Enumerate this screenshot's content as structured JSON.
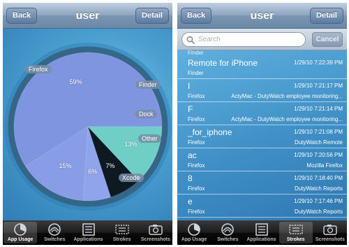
{
  "left": {
    "nav": {
      "back": "Back",
      "title": "user",
      "detail": "Detail"
    },
    "chart_data": {
      "type": "pie",
      "slices": [
        {
          "label": "Firefox",
          "value": 59,
          "value_label": "59%",
          "color": "#7f95e0"
        },
        {
          "label": "Finder",
          "value": 15,
          "value_label": "15%",
          "color": "#889de6"
        },
        {
          "label": "Dock",
          "value": 6,
          "value_label": "6%",
          "color": "#8fa4ea"
        },
        {
          "label": "Other",
          "value": 7,
          "value_label": "7%",
          "color": "#0d1a22"
        },
        {
          "label": "Xcode",
          "value": 13,
          "value_label": "13%",
          "color": "#6fcfc6"
        }
      ]
    },
    "tabs": [
      {
        "label": "App Usage",
        "icon": "app-usage-icon",
        "selected": true
      },
      {
        "label": "Switches",
        "icon": "switches-icon",
        "selected": false
      },
      {
        "label": "Applications",
        "icon": "applications-icon",
        "selected": false
      },
      {
        "label": "Strokes",
        "icon": "strokes-icon",
        "selected": false
      },
      {
        "label": "Screenshots",
        "icon": "screenshots-icon",
        "selected": false
      }
    ]
  },
  "right": {
    "nav": {
      "back": "Back",
      "title": "user",
      "detail": "Detail"
    },
    "search": {
      "placeholder": "Search",
      "cancel": "Cancel"
    },
    "partial_row_text": "Finder",
    "rows": [
      {
        "title": "Remote for iPhone",
        "time": "1/29/10 7:22:39 PM",
        "app": "Finder",
        "detail": ""
      },
      {
        "title": "I",
        "time": "1/29/10 7:21:17 PM",
        "app": "Firefox",
        "detail": "ActyMac - DutyWatch employee monitoring..."
      },
      {
        "title": "F",
        "time": "1/29/10 7:21:14 PM",
        "app": "Firefox",
        "detail": "ActyMac - DutyWatch employee monitoring..."
      },
      {
        "title": "_for_iphone",
        "time": "1/29/10 7:21:08 PM",
        "app": "Firefox",
        "detail": "DutyWatch Remote"
      },
      {
        "title": "ac",
        "time": "1/29/10 7:20:56 PM",
        "app": "Firefox",
        "detail": "Mozilla Firefox"
      },
      {
        "title": "8",
        "time": "1/29/10 7:18:40 PM",
        "app": "Firefox",
        "detail": "DutyWatch Reports"
      },
      {
        "title": "e",
        "time": "1/29/10 7:17:46 PM",
        "app": "Firefox",
        "detail": "DutyWatch Reports"
      }
    ],
    "tabs": [
      {
        "label": "App Usage",
        "icon": "app-usage-icon",
        "selected": false
      },
      {
        "label": "Switches",
        "icon": "switches-icon",
        "selected": false
      },
      {
        "label": "Applications",
        "icon": "applications-icon",
        "selected": false
      },
      {
        "label": "Strokes",
        "icon": "strokes-icon",
        "selected": true
      },
      {
        "label": "Screenshots",
        "icon": "screenshots-icon",
        "selected": false
      }
    ]
  }
}
